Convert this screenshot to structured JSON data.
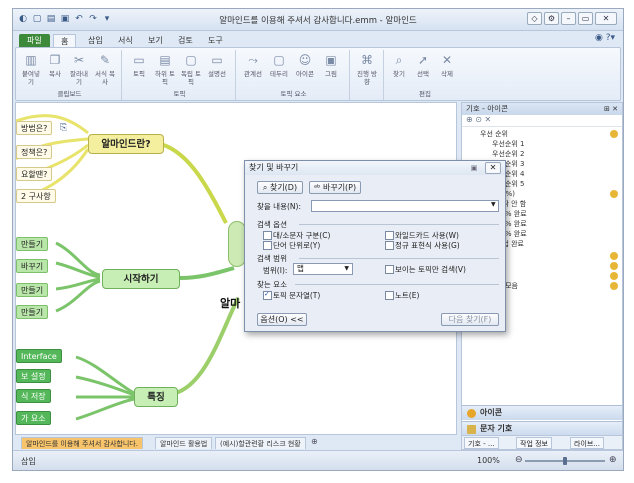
{
  "window": {
    "title": "알마인드를 이용해 주셔서 감사합니다.emm - 알마인드"
  },
  "tabs": [
    "파일",
    "홈",
    "삽입",
    "서식",
    "보기",
    "검토",
    "도구"
  ],
  "ribbon": {
    "groups": [
      {
        "label": "클립보드",
        "buttons": [
          "붙여넣기",
          "복사",
          "잘라내기",
          "서식 복사"
        ]
      },
      {
        "label": "토픽",
        "buttons": [
          "토픽",
          "하위 토픽",
          "독립 토픽",
          "설명선"
        ]
      },
      {
        "label": "토픽 요소",
        "buttons": [
          "관계선",
          "테두리",
          "아이콘",
          "그림"
        ]
      },
      {
        "label": "",
        "buttons": [
          "진행 방향"
        ]
      },
      {
        "label": "편집",
        "buttons": [
          "찾기",
          "선택",
          "삭제"
        ]
      }
    ]
  },
  "mindmap": {
    "central": "알마",
    "topics": {
      "what": "알마인드란?",
      "start": "시작하기",
      "features": "특징"
    },
    "leaves_what": [
      "방법은?",
      "정책은?",
      "요할땐?",
      "2 구사항"
    ],
    "leaves_start": [
      "만들기",
      "바꾸기",
      "만들기",
      "만들기"
    ],
    "leaves_features": [
      "Interface",
      "보 설정",
      "식 저장",
      "가 요소"
    ]
  },
  "doc_tabs": [
    "알마인드를 이용해 주셔서 감사합니다.",
    "알마인드 활용법",
    "(예시)할관련황 리스크 현황"
  ],
  "status": {
    "mode": "삽입",
    "zoom": "100%",
    "zoom_level": 0.5
  },
  "panel": {
    "title": "기호 - 아이콘",
    "tree": [
      "우선 순위",
      "우선순위 1",
      "우선순위 2",
      "우선순위 3",
      "우선순위 4",
      "우선순위 5",
      "행률(%)",
      "시작 안 함",
      "25% 완료",
      "50% 완료",
      "75% 완료",
      "작업 완료",
      "가림",
      "깃표",
      "할",
      "기존 모음"
    ],
    "bars": [
      "아이콘",
      "문자 기호"
    ],
    "bottom_tabs": [
      "기호 - ...",
      "작업 정보",
      "라이브..."
    ]
  },
  "dialog": {
    "title": "찾기 및 바꾸기",
    "find_tab": "찾기(D)",
    "replace_tab": "바꾸기(P)",
    "find_label": "찾을 내용(N):",
    "find_value": "",
    "search_options": "검색 옵션",
    "opt_case": "대/소문자 구분(C)",
    "opt_whole": "단어 단위로(Y)",
    "opt_wildcard": "와일드카드 사용(W)",
    "opt_regex": "정규 표현식 사용(G)",
    "search_scope": "검색 범위",
    "scope_label": "범위(I):",
    "scope_value": "맵",
    "opt_visible": "보이는 토픽만 검색(V)",
    "search_elements": "찾는 요소",
    "el_topic": "토픽 문자열(T)",
    "el_note": "노트(E)",
    "options_btn": "옵션(O) <<",
    "next_btn": "다음 찾기(F)"
  }
}
